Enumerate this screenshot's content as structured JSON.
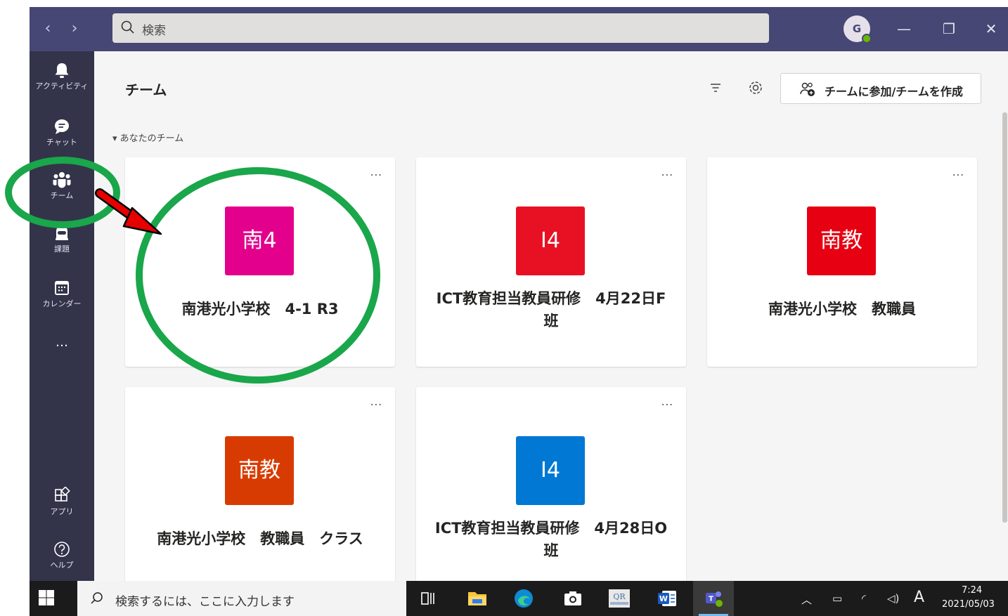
{
  "titlebar": {
    "search_placeholder": "検索",
    "avatar_initial": "G",
    "window_buttons": {
      "minimize": "—",
      "maximize": "❐",
      "close": "✕"
    }
  },
  "sidebar": {
    "items": [
      {
        "label": "アクティビティ",
        "icon": "bell-icon"
      },
      {
        "label": "チャット",
        "icon": "chat-icon"
      },
      {
        "label": "チーム",
        "icon": "teams-icon"
      },
      {
        "label": "課題",
        "icon": "assignments-icon"
      },
      {
        "label": "カレンダー",
        "icon": "calendar-icon"
      },
      {
        "label": "…",
        "icon": "more-icon"
      },
      {
        "label": "アプリ",
        "icon": "apps-icon"
      },
      {
        "label": "ヘルプ",
        "icon": "help-icon"
      }
    ]
  },
  "header": {
    "title": "チーム",
    "join_button": "チームに参加/チームを作成"
  },
  "section": {
    "label": "あなたのチーム"
  },
  "teams": [
    {
      "abbr": "南4",
      "name": "南港光小学校　4-1 R3",
      "color": "#e3008c",
      "more": "..."
    },
    {
      "abbr": "I4",
      "name": "ICT教育担当教員研修　4月22日F班",
      "color": "#e81123",
      "more": "..."
    },
    {
      "abbr": "南教",
      "name": "南港光小学校　教職員",
      "color": "#e60012",
      "more": "..."
    },
    {
      "abbr": "南教",
      "name": "南港光小学校　教職員　クラス",
      "color": "#d83b01",
      "more": "..."
    },
    {
      "abbr": "I4",
      "name": "ICT教育担当教員研修　4月28日O班",
      "color": "#0078d4",
      "more": "..."
    }
  ],
  "taskbar": {
    "search_placeholder": "検索するには、ここに入力します",
    "clock_time": "7:24",
    "clock_date": "2021/05/03",
    "ime": "A"
  },
  "colors": {
    "titlebar": "#464775",
    "sidebar": "#33344a",
    "highlight_circle": "#1aa64a",
    "arrow": "#e60000"
  }
}
